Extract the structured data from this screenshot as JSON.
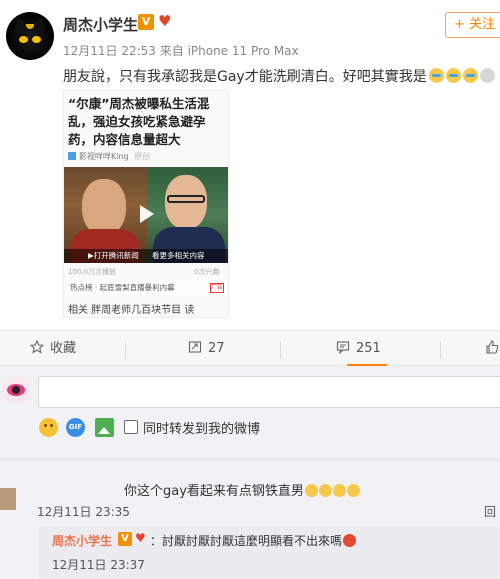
{
  "post": {
    "username": "周杰小学生",
    "verified_badge": "V",
    "heart_badge": "♥",
    "meta": "12月11日 22:53 来自 iPhone 11 Pro Max",
    "follow_label": "+ 关注",
    "text": "朋友說，只有我承認我是Gay才能洗刷清白。好吧其實我是",
    "emojis": [
      "cry-emoji",
      "cry-emoji",
      "cry-emoji",
      "shock-emoji"
    ]
  },
  "card": {
    "title": "“尔康”周杰被曝私生活混乱，强迫女孩吃紧急避孕药，内容信息量超大",
    "source": "影视咩咩King",
    "source_tag": "原创",
    "video_open": "▶打开腾讯新闻",
    "video_more": "看更多相关内容",
    "views": "100.0万次播放",
    "stat_right": "0次兴趣",
    "ad_text": "热点榜 · 起底雪梨直播暴利内幕",
    "ad_tag": "广告",
    "more_text": "相关    胖周老师几百块节目    读"
  },
  "actions": {
    "favorite_icon": "star-icon",
    "favorite_label": "收藏",
    "repost_icon": "repost-icon",
    "repost_count": "27",
    "comment_icon": "comment-icon",
    "comment_count": "251",
    "like_icon": "thumbs-up-icon"
  },
  "composer": {
    "placeholder": "",
    "tools": [
      "emoji-icon",
      "gif-icon",
      "image-icon"
    ],
    "repost_checkbox_label": "同时转发到我的微博"
  },
  "comments": [
    {
      "text": "你这个gay看起来有点钢铁直男",
      "emoji_count": 4,
      "time": "12月11日 23:35",
      "reply_label": "回"
    }
  ],
  "reply": {
    "username": "周杰小学生",
    "text": "：討厭討厭討厭這麼明顯看不出來嗎",
    "time": "12月11日 23:37"
  },
  "colors": {
    "accent": "#ff8200",
    "verified": "#f29100",
    "reply_name": "#eb7350"
  }
}
